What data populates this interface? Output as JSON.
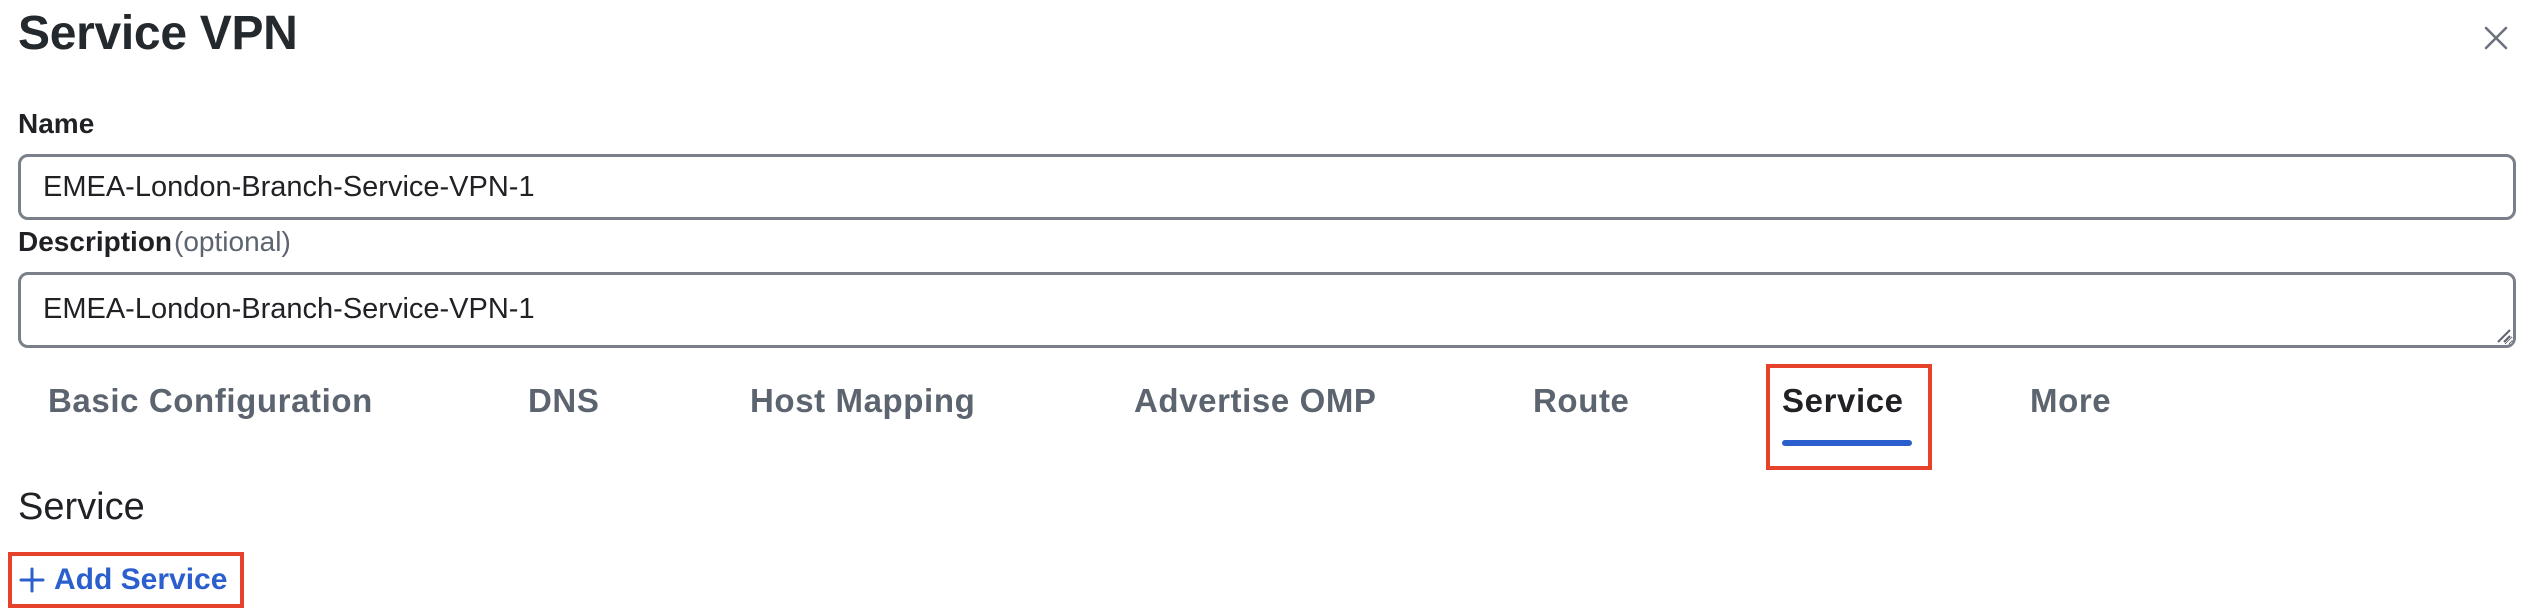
{
  "panel": {
    "title": "Service VPN",
    "close_icon": "close-icon"
  },
  "form": {
    "name": {
      "label": "Name",
      "value": "EMEA-London-Branch-Service-VPN-1"
    },
    "description": {
      "label": "Description",
      "optional_label": "(optional)",
      "value": "EMEA-London-Branch-Service-VPN-1"
    }
  },
  "tabs": [
    {
      "label": "Basic Configuration",
      "active": false
    },
    {
      "label": "DNS",
      "active": false
    },
    {
      "label": "Host Mapping",
      "active": false
    },
    {
      "label": "Advertise OMP",
      "active": false
    },
    {
      "label": "Route",
      "active": false
    },
    {
      "label": "Service",
      "active": true
    },
    {
      "label": "More",
      "active": false
    }
  ],
  "service_section": {
    "title": "Service",
    "add_button_label": "Add Service",
    "add_icon": "plus-icon"
  },
  "colors": {
    "accent": "#2b5fce",
    "highlight": "#e5412b",
    "input_border": "#7a8089",
    "muted_text": "#5c6470"
  }
}
